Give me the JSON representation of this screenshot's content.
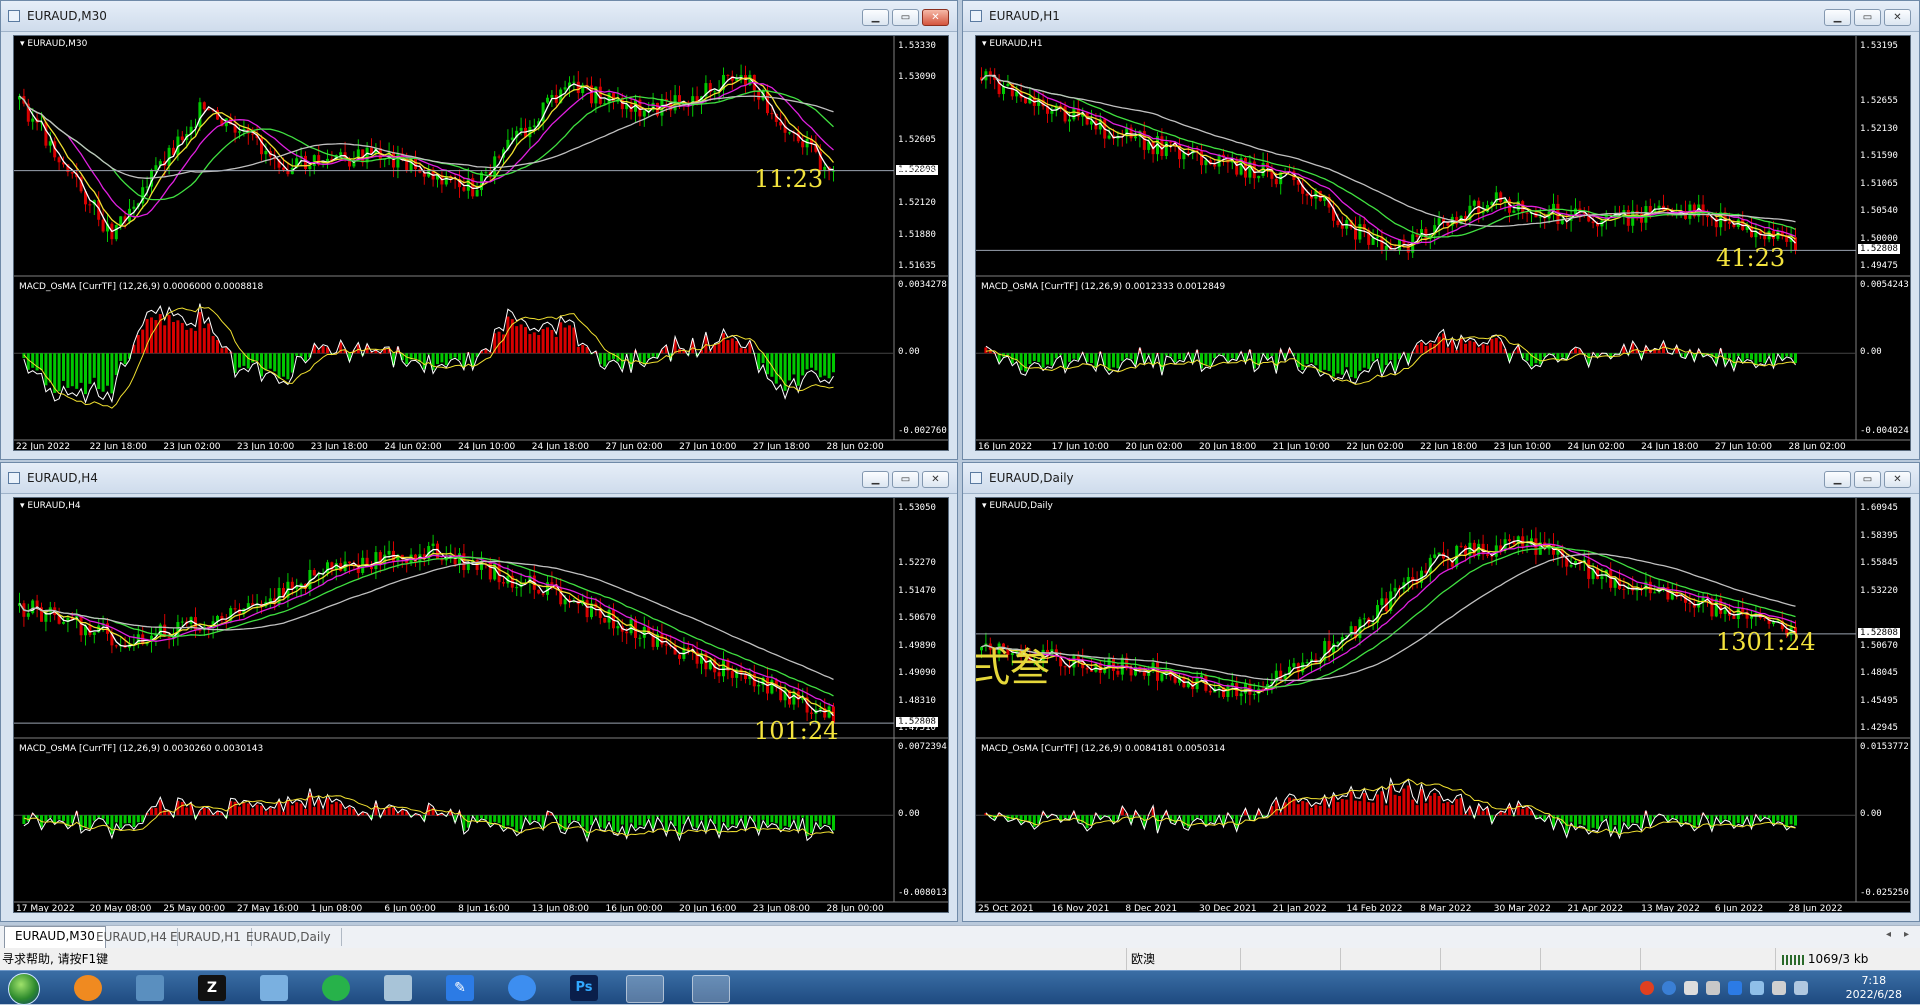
{
  "windows": [
    {
      "id": "m30",
      "title": "EURAUD,M30",
      "symbol_label": "EURAUD,M30",
      "timer": "11:23",
      "price_ticks": [
        "1.53330",
        "1.53090",
        "1.52808",
        "1.52605",
        "1.52365",
        "1.52120",
        "1.51880",
        "1.51635"
      ],
      "current_price": "1.52808",
      "indicator_label": "MACD_OsMA [CurrTF] (12,26,9) 0.0006000 0.0008818",
      "ind_ticks": [
        "0.0034278",
        "0.00",
        "-0.002760"
      ],
      "dates": [
        "22 Jun 2022",
        "22 Jun 18:00",
        "23 Jun 02:00",
        "23 Jun 10:00",
        "23 Jun 18:00",
        "24 Jun 02:00",
        "24 Jun 10:00",
        "24 Jun 18:00",
        "27 Jun 02:00",
        "27 Jun 10:00",
        "27 Jun 18:00",
        "28 Jun 02:00"
      ],
      "overlay_text": ""
    },
    {
      "id": "h1",
      "title": "EURAUD,H1",
      "symbol_label": "EURAUD,H1",
      "timer": "41:23",
      "price_ticks": [
        "1.53195",
        "1.52808",
        "1.52655",
        "1.52130",
        "1.51590",
        "1.51065",
        "1.50540",
        "1.50000",
        "1.49475"
      ],
      "current_price": "1.52808",
      "indicator_label": "MACD_OsMA [CurrTF] (12,26,9) 0.0012333 0.0012849",
      "ind_ticks": [
        "0.0054243",
        "0.00",
        "-0.004024"
      ],
      "dates": [
        "16 Jun 2022",
        "17 Jun 10:00",
        "20 Jun 02:00",
        "20 Jun 18:00",
        "21 Jun 10:00",
        "22 Jun 02:00",
        "22 Jun 18:00",
        "23 Jun 10:00",
        "24 Jun 02:00",
        "24 Jun 18:00",
        "27 Jun 10:00",
        "28 Jun 02:00"
      ],
      "overlay_text": ""
    },
    {
      "id": "h4",
      "title": "EURAUD,H4",
      "symbol_label": "EURAUD,H4",
      "timer": "101:24",
      "price_ticks": [
        "1.53050",
        "1.52808",
        "1.52270",
        "1.51470",
        "1.50670",
        "1.49890",
        "1.49090",
        "1.48310",
        "1.47510"
      ],
      "current_price": "1.52808",
      "indicator_label": "MACD_OsMA [CurrTF] (12,26,9) 0.0030260 0.0030143",
      "ind_ticks": [
        "0.0072394",
        "0.00",
        "-0.008013"
      ],
      "dates": [
        "17 May 2022",
        "20 May 08:00",
        "25 May 00:00",
        "27 May 16:00",
        "1 Jun 08:00",
        "6 Jun 00:00",
        "8 Jun 16:00",
        "13 Jun 08:00",
        "16 Jun 00:00",
        "20 Jun 16:00",
        "23 Jun 08:00",
        "28 Jun 00:00"
      ],
      "overlay_text": ""
    },
    {
      "id": "d1",
      "title": "EURAUD,Daily",
      "symbol_label": "EURAUD,Daily",
      "timer": "1301:24",
      "price_ticks": [
        "1.60945",
        "1.58395",
        "1.55845",
        "1.53220",
        "1.52808",
        "1.50670",
        "1.48045",
        "1.45495",
        "1.42945"
      ],
      "current_price": "1.52808",
      "indicator_label": "MACD_OsMA [CurrTF] (12,26,9) 0.0084181 0.0050314",
      "ind_ticks": [
        "0.0153772",
        "0.00",
        "-0.025250"
      ],
      "dates": [
        "25 Oct 2021",
        "16 Nov 2021",
        "8 Dec 2021",
        "30 Dec 2021",
        "21 Jan 2022",
        "14 Feb 2022",
        "8 Mar 2022",
        "30 Mar 2022",
        "21 Apr 2022",
        "13 May 2022",
        "6 Jun 2022",
        "28 Jun 2022"
      ],
      "overlay_text": "弍叁"
    }
  ],
  "tabs": [
    "EURAUD,M30",
    "EURAUD,H4",
    "EURAUD,H1",
    "EURAUD,Daily"
  ],
  "active_tab": 0,
  "status": {
    "help": "寻求帮助, 请按F1键",
    "profile": "欧澳",
    "traffic": "1069/3 kb"
  },
  "taskbar": {
    "time": "7:18",
    "date": "2022/6/28"
  },
  "colors": {
    "bull": "#00c800",
    "bear": "#d80000",
    "ma_fast": "#ffffff",
    "ma_yellow": "#f0e030",
    "ma_magenta": "#e020e0",
    "ma_green": "#40e040",
    "ma_gray": "#c0c0c0",
    "timer": "#f3e33d"
  }
}
